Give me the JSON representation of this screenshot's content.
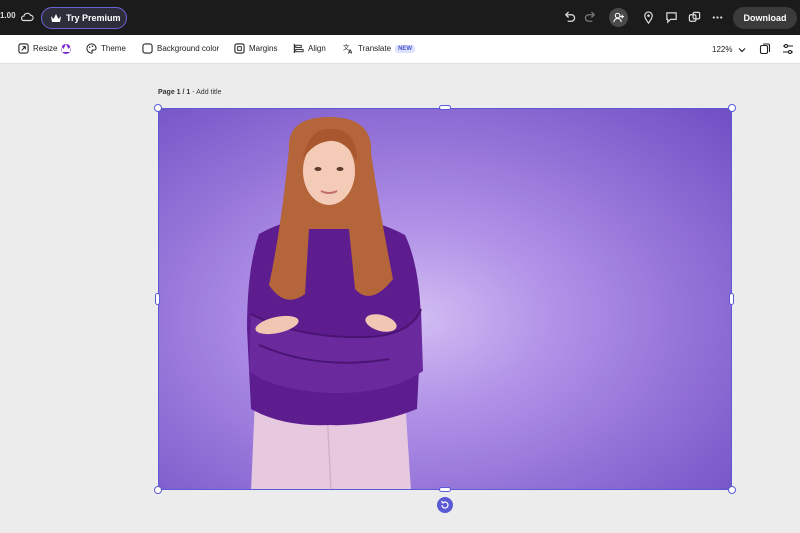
{
  "topbar": {
    "credit_value": "1.00",
    "premium_label": "Try Premium",
    "download_label": "Download"
  },
  "toolbar": {
    "resize_label": "Resize",
    "theme_label": "Theme",
    "background_label": "Background color",
    "margins_label": "Margins",
    "align_label": "Align",
    "translate_label": "Translate",
    "new_badge": "NEW",
    "zoom_value": "122%"
  },
  "canvas": {
    "page_indicator": "Page 1 / 1",
    "separator": " - ",
    "add_title": "Add title"
  },
  "colors": {
    "accent": "#5b5ad6",
    "topbar_bg": "#1b1b1b",
    "premium_border": "#6a63d8"
  }
}
